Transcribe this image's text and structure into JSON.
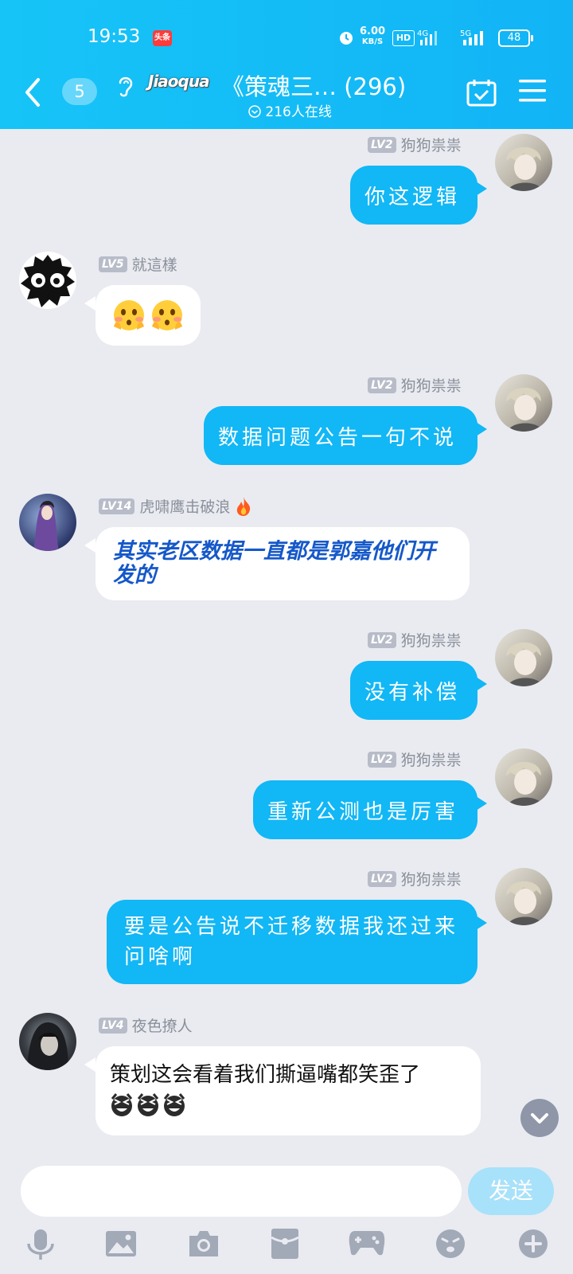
{
  "status_bar": {
    "time": "19:53",
    "news_badge": "头条",
    "net_speed": "6.00",
    "net_unit": "KB/S",
    "hd": "HD",
    "net1": "4G",
    "net2": "5G",
    "battery": "48"
  },
  "header": {
    "unread_count": "5",
    "logo_text": "Jiaoqua",
    "title": "《策魂三…  (296)",
    "online": "216人在线"
  },
  "messages": [
    {
      "side": "me",
      "level": "LV2",
      "name": "狗狗祟祟",
      "text": "你这逻辑"
    },
    {
      "side": "other",
      "level": "LV5",
      "name": "就這樣",
      "text": "",
      "emojis": [
        "flushed-emoji",
        "flushed-emoji"
      ]
    },
    {
      "side": "me",
      "level": "LV2",
      "name": "狗狗祟祟",
      "text": "数据问题公告一句不说"
    },
    {
      "side": "other",
      "level": "LV14",
      "name": "虎啸鹰击破浪",
      "badge": "fire-icon",
      "text": "其实老区数据一直都是郭嘉他们开发的",
      "style": "bold-italic-blue"
    },
    {
      "side": "me",
      "level": "LV2",
      "name": "狗狗祟祟",
      "text": "没有补偿"
    },
    {
      "side": "me",
      "level": "LV2",
      "name": "狗狗祟祟",
      "text": "重新公测也是厉害"
    },
    {
      "side": "me",
      "level": "LV2",
      "name": "狗狗祟祟",
      "text": "要是公告说不迁移数据我还过来问啥啊"
    },
    {
      "side": "other",
      "level": "LV4",
      "name": "夜色撩人",
      "text": "策划这会看着我们撕逼嘴都笑歪了",
      "emojis": [
        "laughing-emoji",
        "laughing-emoji",
        "laughing-emoji"
      ]
    }
  ],
  "input": {
    "placeholder": ""
  },
  "send_label": "发送",
  "toolbar_icons": [
    "microphone-icon",
    "image-icon",
    "camera-icon",
    "red-packet-icon",
    "game-icon",
    "emoji-icon",
    "plus-icon"
  ],
  "colors": {
    "header": "#12b4f6",
    "my_bubble": "#12b7f5",
    "background": "#e9ebf1",
    "send_disabled": "#a8e1fa"
  }
}
